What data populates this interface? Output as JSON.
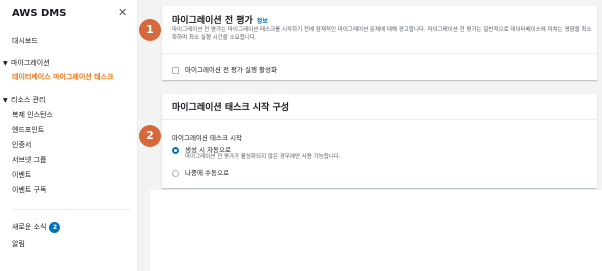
{
  "sidebar": {
    "title": "AWS DMS",
    "close": "✕",
    "dashboard": "대시보드",
    "migration": {
      "title": "마이그레이션",
      "items": [
        "데이터베이스 마이그레이션 태스크"
      ]
    },
    "resources": {
      "title": "리소스 관리",
      "items": [
        "복제 인스턴스",
        "엔드포인트",
        "인증서",
        "서브넷 그룹",
        "이벤트",
        "이벤트 구독"
      ]
    },
    "whats_new": "새로운 소식",
    "whats_new_count": "2",
    "notifications": "알림"
  },
  "steps": [
    "1",
    "2"
  ],
  "premigration": {
    "title": "마이그레이션 전 평가",
    "info": "정보",
    "description": "마이그레이션 전 평가는 마이그레이션 태스크를 시작하기 전에 잠재적인 마이그레이션 문제에 대해 경고합니다. 마이그레이션 전 평가는 일반적으로 데이터베이스에 미치는 영향을 최소화하며 최소 실행 시간을 소요합니다.",
    "checkbox_label": "마이그레이션 전 평가 실행 활성화"
  },
  "startup": {
    "title": "마이그레이션 태스크 시작 구성",
    "field_label": "마이그레이션 태스크 시작",
    "options": [
      {
        "label": "생성 시 자동으로",
        "sub": "마이그레이션 전 평가가 활성화되지 않은 경우에만 사용 가능합니다.",
        "selected": true
      },
      {
        "label": "나중에 수동으로",
        "sub": "",
        "selected": false
      }
    ]
  },
  "colors": {
    "accent": "#ec7211",
    "link": "#0073bb",
    "step": "#d5693b"
  }
}
